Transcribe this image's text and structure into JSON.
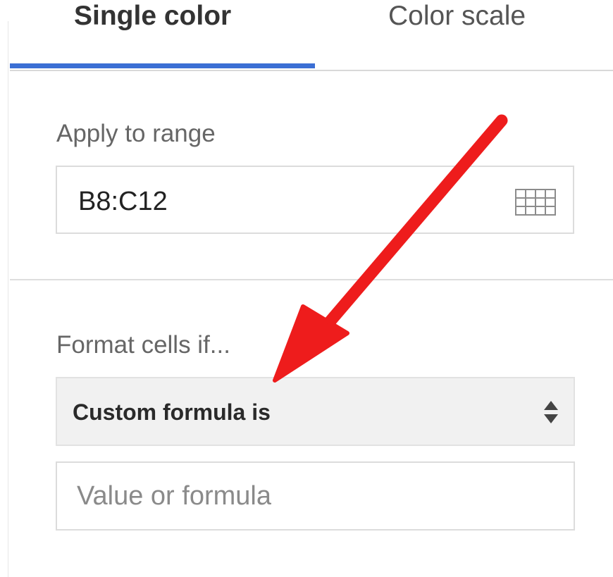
{
  "tabs": {
    "single_color": "Single color",
    "color_scale": "Color scale",
    "active": "single_color"
  },
  "apply_to_range": {
    "label": "Apply to range",
    "value": "B8:C12",
    "icon": "grid-select-icon"
  },
  "format_cells_if": {
    "label": "Format cells if...",
    "selected_condition": "Custom formula is",
    "icon": "updown-arrows-icon"
  },
  "value_or_formula": {
    "value": "",
    "placeholder": "Value or formula"
  },
  "annotation": {
    "type": "red-arrow",
    "color": "#ee1c1c"
  },
  "colors": {
    "accent": "#3b6fd4"
  }
}
